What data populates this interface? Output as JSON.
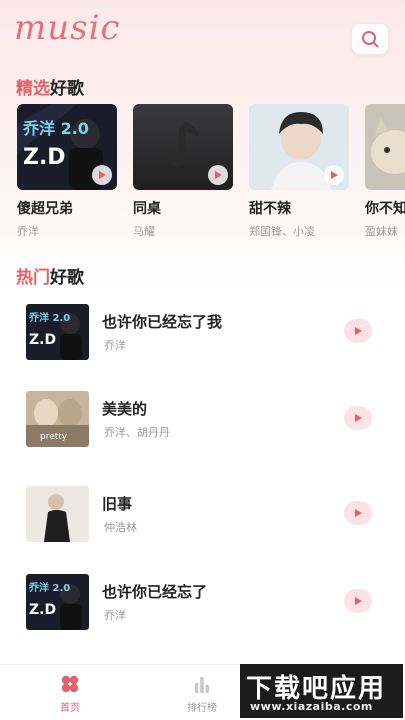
{
  "app": {
    "logo_text": "music"
  },
  "colors": {
    "accent": "#e4606b",
    "text": "#222222",
    "muted": "#999999",
    "play_bg": "#fbe3e5"
  },
  "featured": {
    "title_accent": "精选",
    "title_rest": "好歌",
    "items": [
      {
        "title": "傻超兄弟",
        "artist": "乔洋"
      },
      {
        "title": "同桌",
        "artist": "马耀"
      },
      {
        "title": "甜不辣",
        "artist": "郑国锋、小凌"
      },
      {
        "title": "你不知",
        "artist": "盈妹妹"
      }
    ]
  },
  "hot": {
    "title_accent": "热门",
    "title_rest": "好歌",
    "songs": [
      {
        "title": "也许你已经忘了我",
        "artist": "乔洋"
      },
      {
        "title": "美美的",
        "artist": "乔洋、胡丹丹",
        "cover_text": "pretty"
      },
      {
        "title": "旧事",
        "artist": "仲浩林"
      },
      {
        "title": "也许你已经忘了",
        "artist": "乔洋"
      }
    ]
  },
  "cover_art_text": "乔洋 2.0",
  "tabbar": {
    "tabs": [
      {
        "label": "首页",
        "icon": "home-grid-icon",
        "active": true
      },
      {
        "label": "排行榜",
        "icon": "bar-chart-icon",
        "active": false
      }
    ]
  },
  "watermark": {
    "main": "下载吧应用",
    "sub": "www.xiazaiba.com"
  }
}
